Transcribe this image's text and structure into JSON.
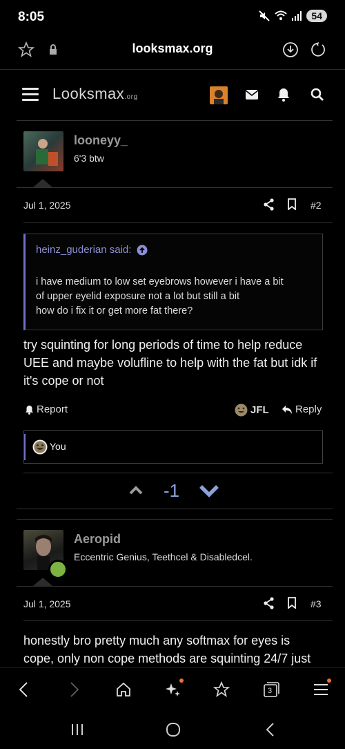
{
  "status": {
    "time": "8:05",
    "battery": "54"
  },
  "browser": {
    "url": "looksmax.org",
    "tab_count": "3"
  },
  "site": {
    "logo_main": "Looksmax",
    "logo_suffix": ".org"
  },
  "posts": [
    {
      "username": "looneyy_",
      "user_title": "6'3 btw",
      "date": "Jul 1, 2025",
      "number": "#2",
      "quote": {
        "author_label": "heinz_guderian said:",
        "lines": [
          "i have medium to low set eyebrows however i have a bit",
          "of upper eyelid exposure not a lot but still a bit",
          "how do i fix it or get more fat there?"
        ]
      },
      "body_lines": [
        "try squinting for long periods of time to help reduce",
        "UEE and maybe volufline to help with the fat but idk if",
        "it's cope or not"
      ],
      "actions": {
        "report": "Report",
        "jfl": "JFL",
        "reply": "Reply"
      },
      "reactions_label": "You",
      "vote_score": "-1"
    },
    {
      "username": "Aeropid",
      "user_title": "Eccentric Genius, Teethcel & Disabledcel.",
      "date": "Jul 1, 2025",
      "number": "#3",
      "body_lines": [
        "honestly bro pretty much any softmax for eyes is",
        "cope, only non cope methods are squinting 24/7 just"
      ]
    }
  ],
  "colors": {
    "quote_border": "#6f72c8",
    "vote_blue": "#8da1d9",
    "badge": "#f07030",
    "online": "#7cb342"
  }
}
